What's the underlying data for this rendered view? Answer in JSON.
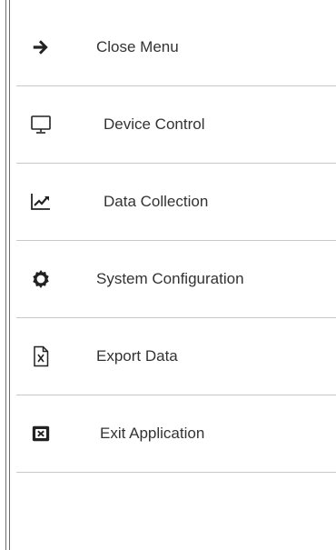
{
  "menu": {
    "items": [
      {
        "label": "Close Menu",
        "icon": "arrow-right-icon"
      },
      {
        "label": "Device Control",
        "icon": "monitor-icon"
      },
      {
        "label": "Data Collection",
        "icon": "line-chart-icon"
      },
      {
        "label": "System Configuration",
        "icon": "gear-icon"
      },
      {
        "label": "Export Data",
        "icon": "excel-file-icon"
      },
      {
        "label": "Exit Application",
        "icon": "close-box-icon"
      }
    ]
  }
}
